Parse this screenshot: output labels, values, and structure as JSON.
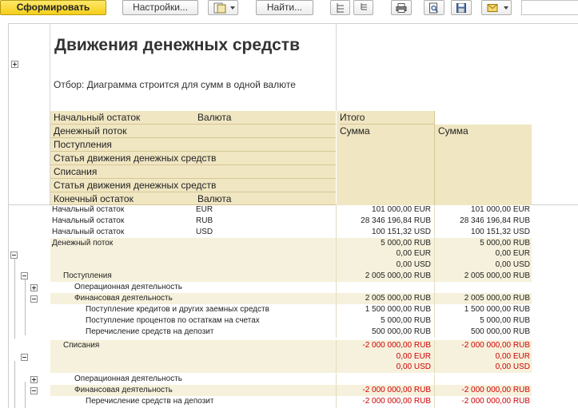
{
  "toolbar": {
    "generate_label": "Сформировать",
    "settings_label": "Настройки...",
    "find_label": "Найти..."
  },
  "report": {
    "title": "Движения денежных средств",
    "filter": "Отбор: Диаграмма строится для сумм в одной валюте"
  },
  "header": {
    "rows": [
      "Начальный остаток",
      "Денежный поток",
      "Поступления",
      "Статья движения денежных средств",
      "Списания",
      "Статья движения денежных средств",
      "Конечный остаток"
    ],
    "currency_label": "Валюта",
    "total_label": "Итого",
    "sum_label": "Сумма"
  },
  "body": {
    "rows": [
      {
        "label": "Начальный остаток",
        "currency": "EUR",
        "v1": "101 000,00 EUR",
        "v2": "101 000,00 EUR"
      },
      {
        "label": "Начальный остаток",
        "currency": "RUB",
        "v1": "28 346 196,84 RUB",
        "v2": "28 346 196,84 RUB"
      },
      {
        "label": "Начальный остаток",
        "currency": "USD",
        "v1": "100 151,32 USD",
        "v2": "100 151,32 USD"
      },
      {
        "label": "Денежный поток",
        "currency": "",
        "v1": "5 000,00 RUB",
        "v2": "5 000,00 RUB",
        "v1b": "0,00 EUR",
        "v2b": "0,00 EUR",
        "v1c": "0,00 USD",
        "v2c": "0,00 USD"
      },
      {
        "label": "Поступления",
        "currency": "",
        "v1": "2 005 000,00 RUB",
        "v2": "2 005 000,00 RUB"
      },
      {
        "label": "Операционная деятельность",
        "currency": "",
        "v1": "",
        "v2": ""
      },
      {
        "label": "Финансовая деятельность",
        "currency": "",
        "v1": "2 005 000,00 RUB",
        "v2": "2 005 000,00 RUB"
      },
      {
        "label": "Поступление кредитов и других заемных средств",
        "currency": "",
        "v1": "1 500 000,00 RUB",
        "v2": "1 500 000,00 RUB"
      },
      {
        "label": "Поступление процентов по остаткам на счетах",
        "currency": "",
        "v1": "5 000,00 RUB",
        "v2": "5 000,00 RUB"
      },
      {
        "label": "Перечисление средств на депозит",
        "currency": "",
        "v1": "500 000,00 RUB",
        "v2": "500 000,00 RUB"
      },
      {
        "label": "Списания",
        "currency": "",
        "v1": "-2 000 000,00 RUB",
        "v2": "-2 000 000,00 RUB",
        "v1b": "0,00 EUR",
        "v2b": "0,00 EUR",
        "v1c": "0,00 USD",
        "v2c": "0,00 USD"
      },
      {
        "label": "Операционная деятельность",
        "currency": "",
        "v1": "",
        "v2": ""
      },
      {
        "label": "Финансовая деятельность",
        "currency": "",
        "v1": "-2 000 000,00 RUB",
        "v2": "-2 000 000,00 RUB"
      },
      {
        "label": "Перечисление средств на депозит",
        "currency": "",
        "v1": "-2 000 000,00 RUB",
        "v2": "-2 000 000,00 RUB"
      }
    ]
  },
  "colors": {
    "header_bg": "#f0e6c2",
    "group_bg": "#f6f1dc",
    "negative": "#d00000",
    "accent_button": "#f5cf1b"
  }
}
